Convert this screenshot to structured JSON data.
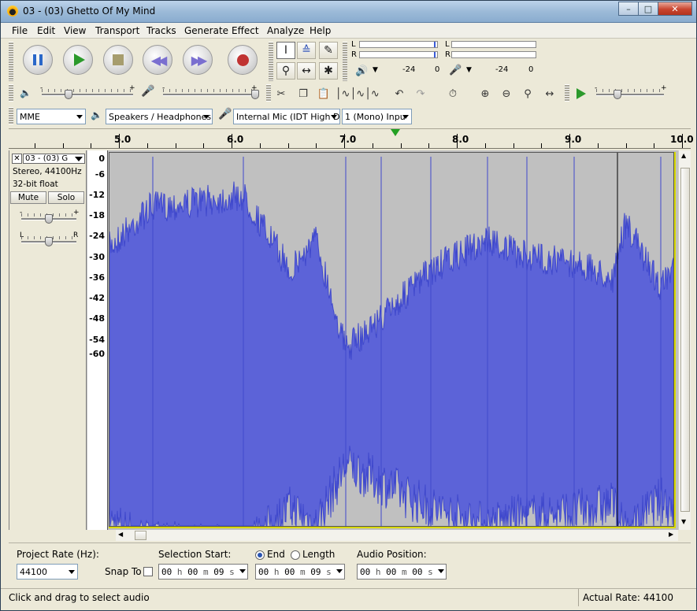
{
  "window": {
    "title": "03 - (03) Ghetto Of My Mind"
  },
  "menu": [
    "File",
    "Edit",
    "View",
    "Transport",
    "Tracks",
    "Generate",
    "Effect",
    "Analyze",
    "Help"
  ],
  "meters": {
    "playback": {
      "l": "L",
      "r": "R",
      "scale": [
        "-24",
        "0"
      ]
    },
    "record": {
      "l": "L",
      "r": "R",
      "scale": [
        "-24",
        "0"
      ]
    }
  },
  "devices": {
    "host": "MME",
    "output": "Speakers / Headphones",
    "input": "Internal Mic (IDT High D",
    "channels": "1 (Mono) Inpu"
  },
  "ruler": {
    "labels": [
      "5.0",
      "6.0",
      "7.0",
      "8.0",
      "9.0",
      "10.0"
    ]
  },
  "track": {
    "name": "03 - (03) G",
    "format": "Stereo, 44100Hz",
    "bitdepth": "32-bit float",
    "mute": "Mute",
    "solo": "Solo",
    "gain_minus": "-",
    "gain_plus": "+",
    "pan_left": "L",
    "pan_right": "R",
    "db_scale": [
      "0",
      "-6",
      "-12",
      "-18",
      "-24",
      "-30",
      "-36",
      "-42",
      "-48",
      "-54",
      "-60"
    ]
  },
  "selection": {
    "project_rate_label": "Project Rate (Hz):",
    "project_rate": "44100",
    "snap_label": "Snap To",
    "start_label": "Selection Start:",
    "end_label": "End",
    "length_label": "Length",
    "audio_pos_label": "Audio Position:",
    "start_time": {
      "h": "00",
      "m": "00",
      "s": "09"
    },
    "end_time": {
      "h": "00",
      "m": "00",
      "s": "09"
    },
    "audio_time": {
      "h": "00",
      "m": "00",
      "s": "00"
    }
  },
  "status": {
    "left": "Click and drag to select audio",
    "right": "Actual Rate: 44100"
  },
  "colors": {
    "waveform": "#3f48cc",
    "waveform_fill": "#5c63d8",
    "background": "#c0c0c0"
  }
}
